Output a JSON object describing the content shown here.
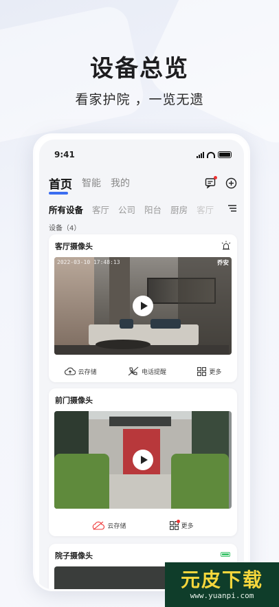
{
  "hero": {
    "title": "设备总览",
    "subtitle": "看家护院 ，一览无遗"
  },
  "status": {
    "time": "9:41"
  },
  "nav": {
    "tabs": [
      "首页",
      "智能",
      "我的"
    ]
  },
  "rooms": {
    "tabs": [
      "所有设备",
      "客厅",
      "公司",
      "阳台",
      "厨房",
      "客厅"
    ]
  },
  "devices": {
    "count_label": "设备（4）"
  },
  "cards": [
    {
      "title": "客厅摄像头",
      "timestamp": "2022-03-10 17:48:13",
      "brand": "乔安",
      "actions": [
        "云存储",
        "电话提醒",
        "更多"
      ]
    },
    {
      "title": "前门摄像头",
      "actions": [
        "云存储",
        "更多"
      ]
    },
    {
      "title": "院子摄像头"
    }
  ],
  "watermark": {
    "line1": "元皮下载",
    "line2": "www.yuanpi.com"
  },
  "colors": {
    "accent": "#3a6df0",
    "alert": "#e33333",
    "battery": "#3cc46a"
  }
}
